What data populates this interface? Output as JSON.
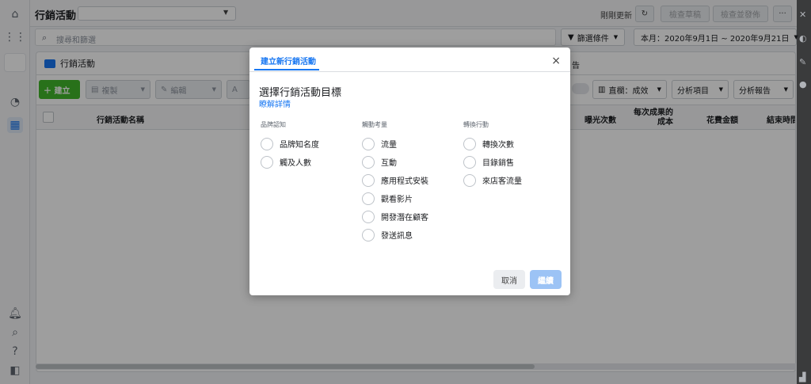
{
  "topbar": {
    "title": "行銷活動",
    "refresh_label": "剛剛更新",
    "review_label": "檢查草稿",
    "publish_label": "檢查並發佈",
    "more_label": "···"
  },
  "search": {
    "placeholder": "搜尋和篩選",
    "filter_label": "篩選條件",
    "date_range": "本月：2020年9月1日 ~ 2020年9月21日"
  },
  "panel": {
    "tab_label": "行銷活動",
    "tab_right_fragment": "告",
    "create_label": "＋ 建立",
    "copy_label": "複製",
    "edit_label": "編輯",
    "ab_fragment": "A",
    "columns_label": "直欄：成效",
    "breakdown_label": "分析項目",
    "reports_label": "分析報告",
    "headers": {
      "name": "行銷活動名稱",
      "impressions": "曝光次數",
      "cost_per_result": "每次成果的成本",
      "amount_spent": "花費金額",
      "end_date": "結束時間"
    }
  },
  "modal": {
    "tab_label": "建立新行銷活動",
    "title": "選擇行銷活動目標",
    "learn_more": "瞭解詳情",
    "close_icon": "×",
    "groups": [
      {
        "heading": "品牌認知",
        "options": [
          "品牌知名度",
          "觸及人數"
        ]
      },
      {
        "heading": "觸動考量",
        "options": [
          "流量",
          "互動",
          "應用程式安裝",
          "觀看影片",
          "開發潛在顧客",
          "發送訊息"
        ]
      },
      {
        "heading": "轉換行動",
        "options": [
          "轉換次數",
          "目錄銷售",
          "來店客流量"
        ]
      }
    ],
    "cancel_label": "取消",
    "continue_label": "繼續"
  }
}
